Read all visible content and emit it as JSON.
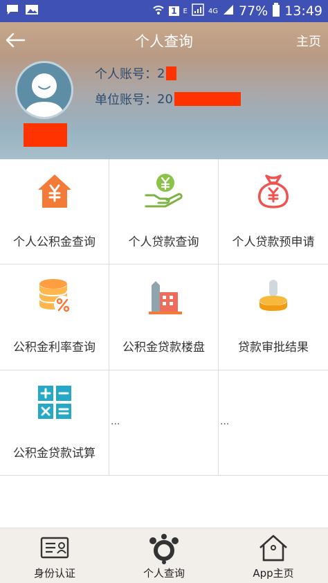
{
  "status_bar": {
    "left_icons": [
      "chat-icon",
      "image-icon"
    ],
    "sim_slot": "1",
    "network_small": "E",
    "network_type": "4G",
    "battery": "77%",
    "time": "13:49"
  },
  "header": {
    "title": "个人查询",
    "home_link": "主页",
    "personal_account_label": "个人账号：",
    "personal_account_value": "2",
    "unit_account_label": "单位账号：",
    "unit_account_value": "20"
  },
  "grid": {
    "items": [
      {
        "label": "个人公积金查询",
        "icon": "house-yuan-icon"
      },
      {
        "label": "个人贷款查询",
        "icon": "hand-coin-icon"
      },
      {
        "label": "个人贷款预申请",
        "icon": "money-bag-icon"
      },
      {
        "label": "公积金利率查询",
        "icon": "coin-stack-percent-icon"
      },
      {
        "label": "公积金贷款楼盘",
        "icon": "buildings-icon"
      },
      {
        "label": "贷款审批结果",
        "icon": "stamp-icon"
      },
      {
        "label": "公积金贷款试算",
        "icon": "calculator-icon"
      },
      {
        "label": "...",
        "icon": ""
      },
      {
        "label": "...",
        "icon": ""
      }
    ]
  },
  "bottom_nav": {
    "items": [
      {
        "label": "身份认证",
        "icon": "id-card-icon"
      },
      {
        "label": "个人查询",
        "icon": "person-query-icon"
      },
      {
        "label": "App主页",
        "icon": "home-icon"
      }
    ]
  },
  "colors": {
    "status_bar": "#3f51b5",
    "redaction": "#ff3300",
    "icon_orange": "#f37b37",
    "icon_green": "#7cb342",
    "icon_red": "#ef5350",
    "icon_teal": "#26a9c6"
  }
}
